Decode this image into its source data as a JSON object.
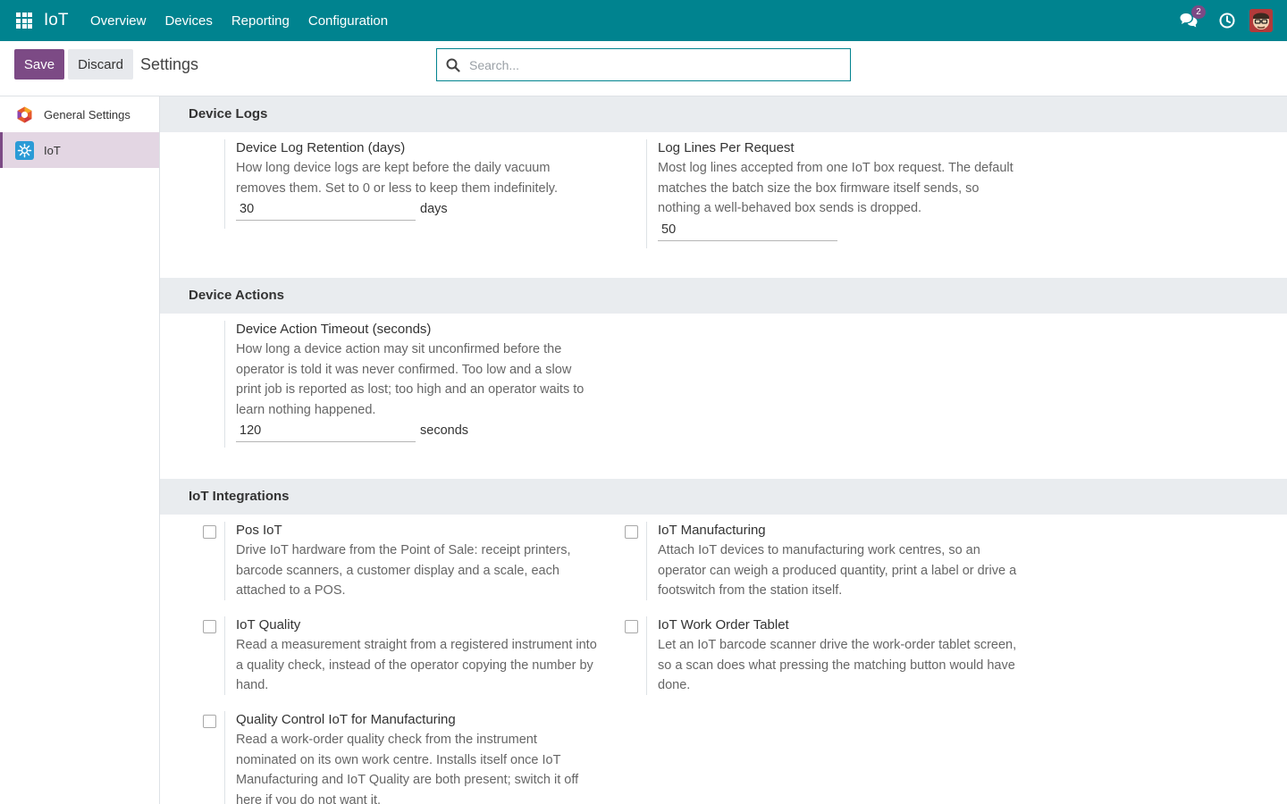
{
  "navbar": {
    "brand": "IoT",
    "menu": [
      "Overview",
      "Devices",
      "Reporting",
      "Configuration"
    ],
    "chat_badge": "2",
    "icons": [
      "apps-grid-icon",
      "chat-icon",
      "clock-icon",
      "avatar"
    ]
  },
  "control": {
    "save_label": "Save",
    "discard_label": "Discard",
    "title": "Settings",
    "search_placeholder": "Search..."
  },
  "sidebar": {
    "items": [
      {
        "label": "General Settings",
        "icon": "odoo-logo-icon",
        "active": false
      },
      {
        "label": "IoT",
        "icon": "iot-icon",
        "active": true
      }
    ]
  },
  "sections": {
    "device_logs": {
      "title": "Device Logs",
      "retention": {
        "title": "Device Log Retention (days)",
        "desc": "How long device logs are kept before the daily vacuum removes them. Set to 0 or less to keep them indefinitely.",
        "value": "30",
        "unit": "days"
      },
      "lines": {
        "title": "Log Lines Per Request",
        "desc": "Most log lines accepted from one IoT box request. The default matches the batch size the box firmware itself sends, so nothing a well-behaved box sends is dropped.",
        "value": "50"
      }
    },
    "device_actions": {
      "title": "Device Actions",
      "timeout": {
        "title": "Device Action Timeout (seconds)",
        "desc": "How long a device action may sit unconfirmed before the operator is told it was never confirmed. Too low and a slow print job is reported as lost; too high and an operator waits to learn nothing happened.",
        "value": "120",
        "unit": "seconds"
      }
    },
    "integrations": {
      "title": "IoT Integrations",
      "items": [
        {
          "title": "Pos IoT",
          "desc": "Drive IoT hardware from the Point of Sale: receipt printers, barcode scanners, a customer display and a scale, each attached to a POS.",
          "checked": false
        },
        {
          "title": "IoT Manufacturing",
          "desc": "Attach IoT devices to manufacturing work centres, so an operator can weigh a produced quantity, print a label or drive a footswitch from the station itself.",
          "checked": false
        },
        {
          "title": "IoT Quality",
          "desc": "Read a measurement straight from a registered instrument into a quality check, instead of the operator copying the number by hand.",
          "checked": false
        },
        {
          "title": "IoT Work Order Tablet",
          "desc": "Let an IoT barcode scanner drive the work-order tablet screen, so a scan does what pressing the matching button would have done.",
          "checked": false
        },
        {
          "title": "Quality Control IoT for Manufacturing",
          "desc": "Read a work-order quality check from the instrument nominated on its own work centre. Installs itself once IoT Manufacturing and IoT Quality are both present; switch it off here if you do not want it.",
          "checked": false
        }
      ]
    }
  },
  "colors": {
    "navbar": "#00838f",
    "primary": "#7c4a85",
    "section_bg": "#e9ecef",
    "sidebar_active": "#e3d6e3"
  }
}
